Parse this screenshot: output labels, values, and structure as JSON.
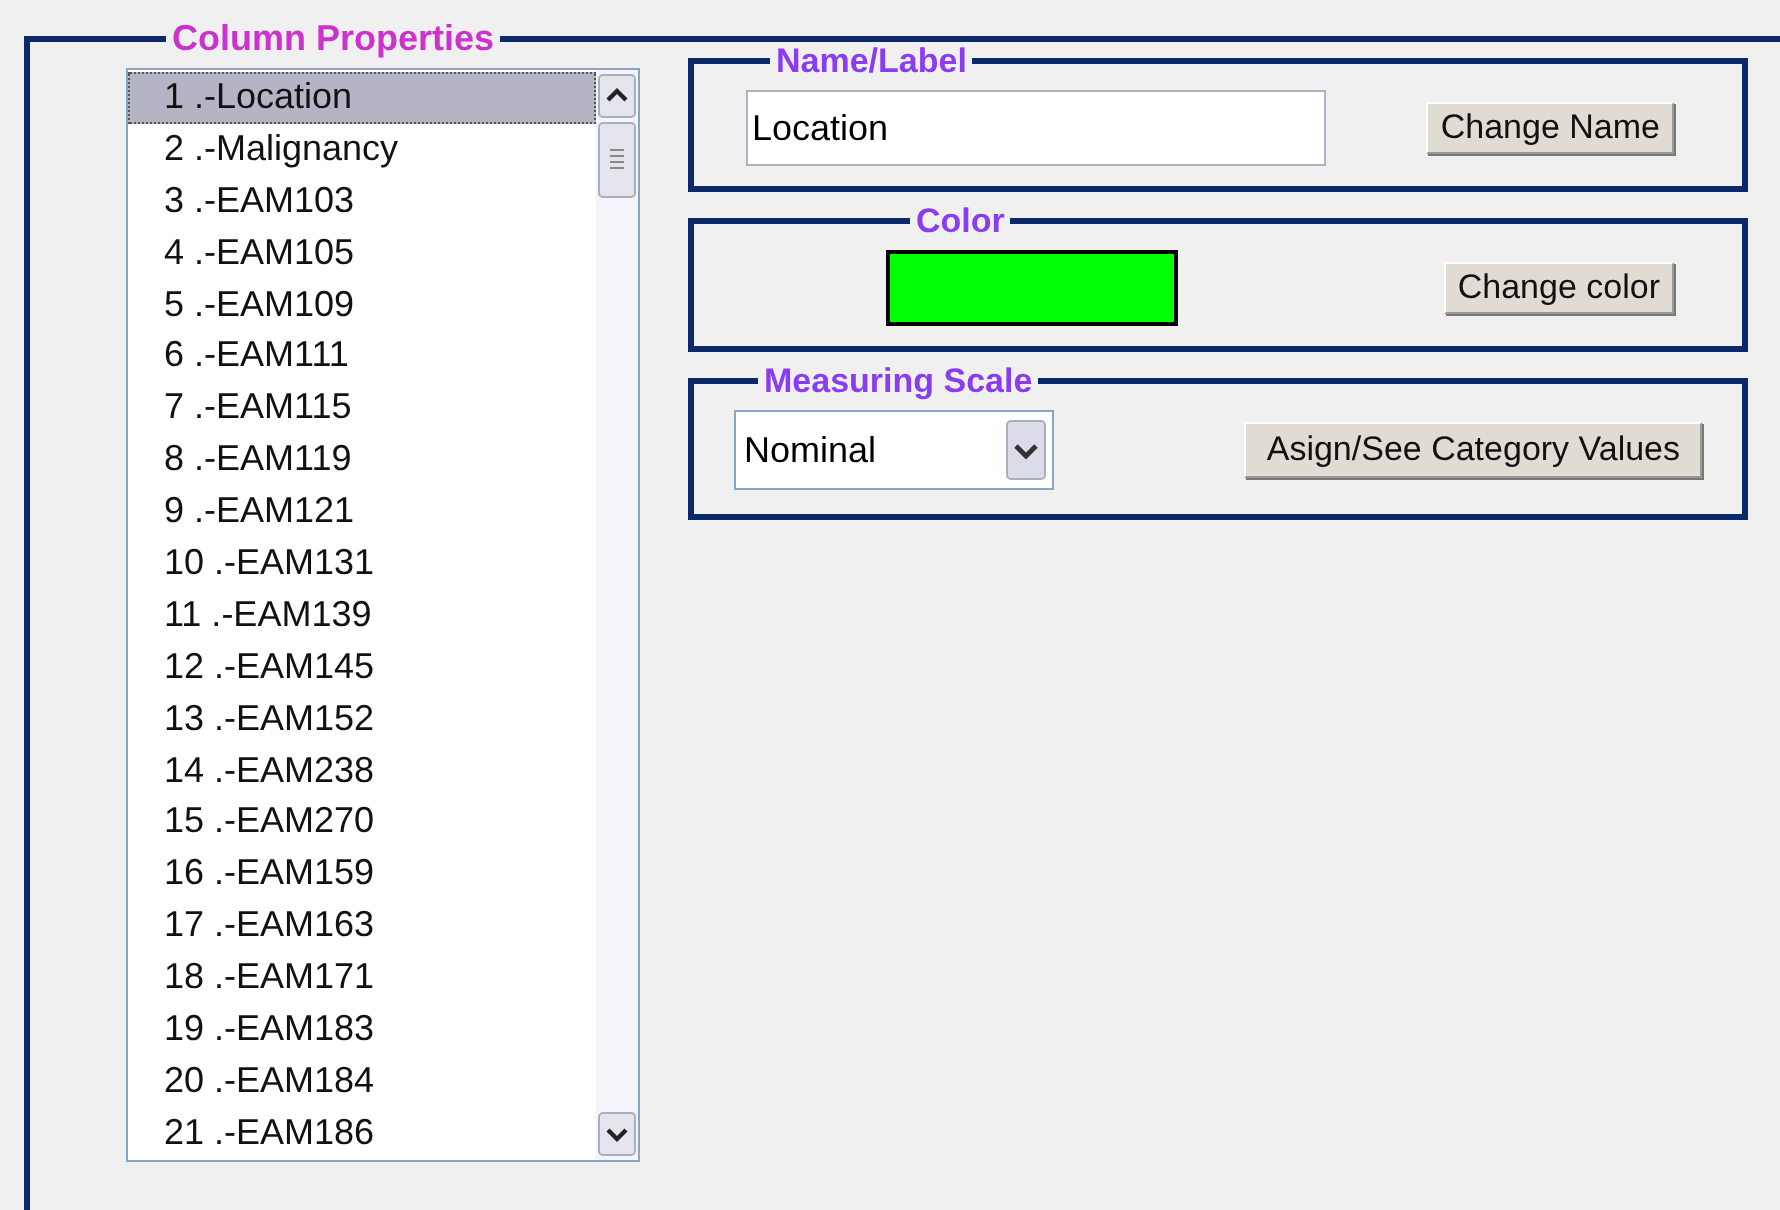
{
  "column_properties": {
    "title": "Column Properties",
    "columns_list": {
      "items": [
        {
          "label": "1 .-Location",
          "selected": true
        },
        {
          "label": "2 .-Malignancy",
          "selected": false
        },
        {
          "label": "3 .-EAM103",
          "selected": false
        },
        {
          "label": "4 .-EAM105",
          "selected": false
        },
        {
          "label": "5 .-EAM109",
          "selected": false
        },
        {
          "label": "6 .-EAM111",
          "selected": false
        },
        {
          "label": "7 .-EAM115",
          "selected": false
        },
        {
          "label": "8 .-EAM119",
          "selected": false
        },
        {
          "label": "9 .-EAM121",
          "selected": false
        },
        {
          "label": "10 .-EAM131",
          "selected": false
        },
        {
          "label": "11 .-EAM139",
          "selected": false
        },
        {
          "label": "12 .-EAM145",
          "selected": false
        },
        {
          "label": "13 .-EAM152",
          "selected": false
        },
        {
          "label": "14 .-EAM238",
          "selected": false
        },
        {
          "label": "15 .-EAM270",
          "selected": false
        },
        {
          "label": "16 .-EAM159",
          "selected": false
        },
        {
          "label": "17 .-EAM163",
          "selected": false
        },
        {
          "label": "18 .-EAM171",
          "selected": false
        },
        {
          "label": "19 .-EAM183",
          "selected": false
        },
        {
          "label": "20 .-EAM184",
          "selected": false
        },
        {
          "label": "21 .-EAM186",
          "selected": false
        }
      ]
    },
    "name_label": {
      "title": "Name/Label",
      "value": "Location",
      "button": "Change Name"
    },
    "color": {
      "title": "Color",
      "color": "#00ff00",
      "button": "Change color"
    },
    "measuring_scale": {
      "title": "Measuring Scale",
      "value": "Nominal",
      "button": "Asign/See Category Values"
    }
  }
}
